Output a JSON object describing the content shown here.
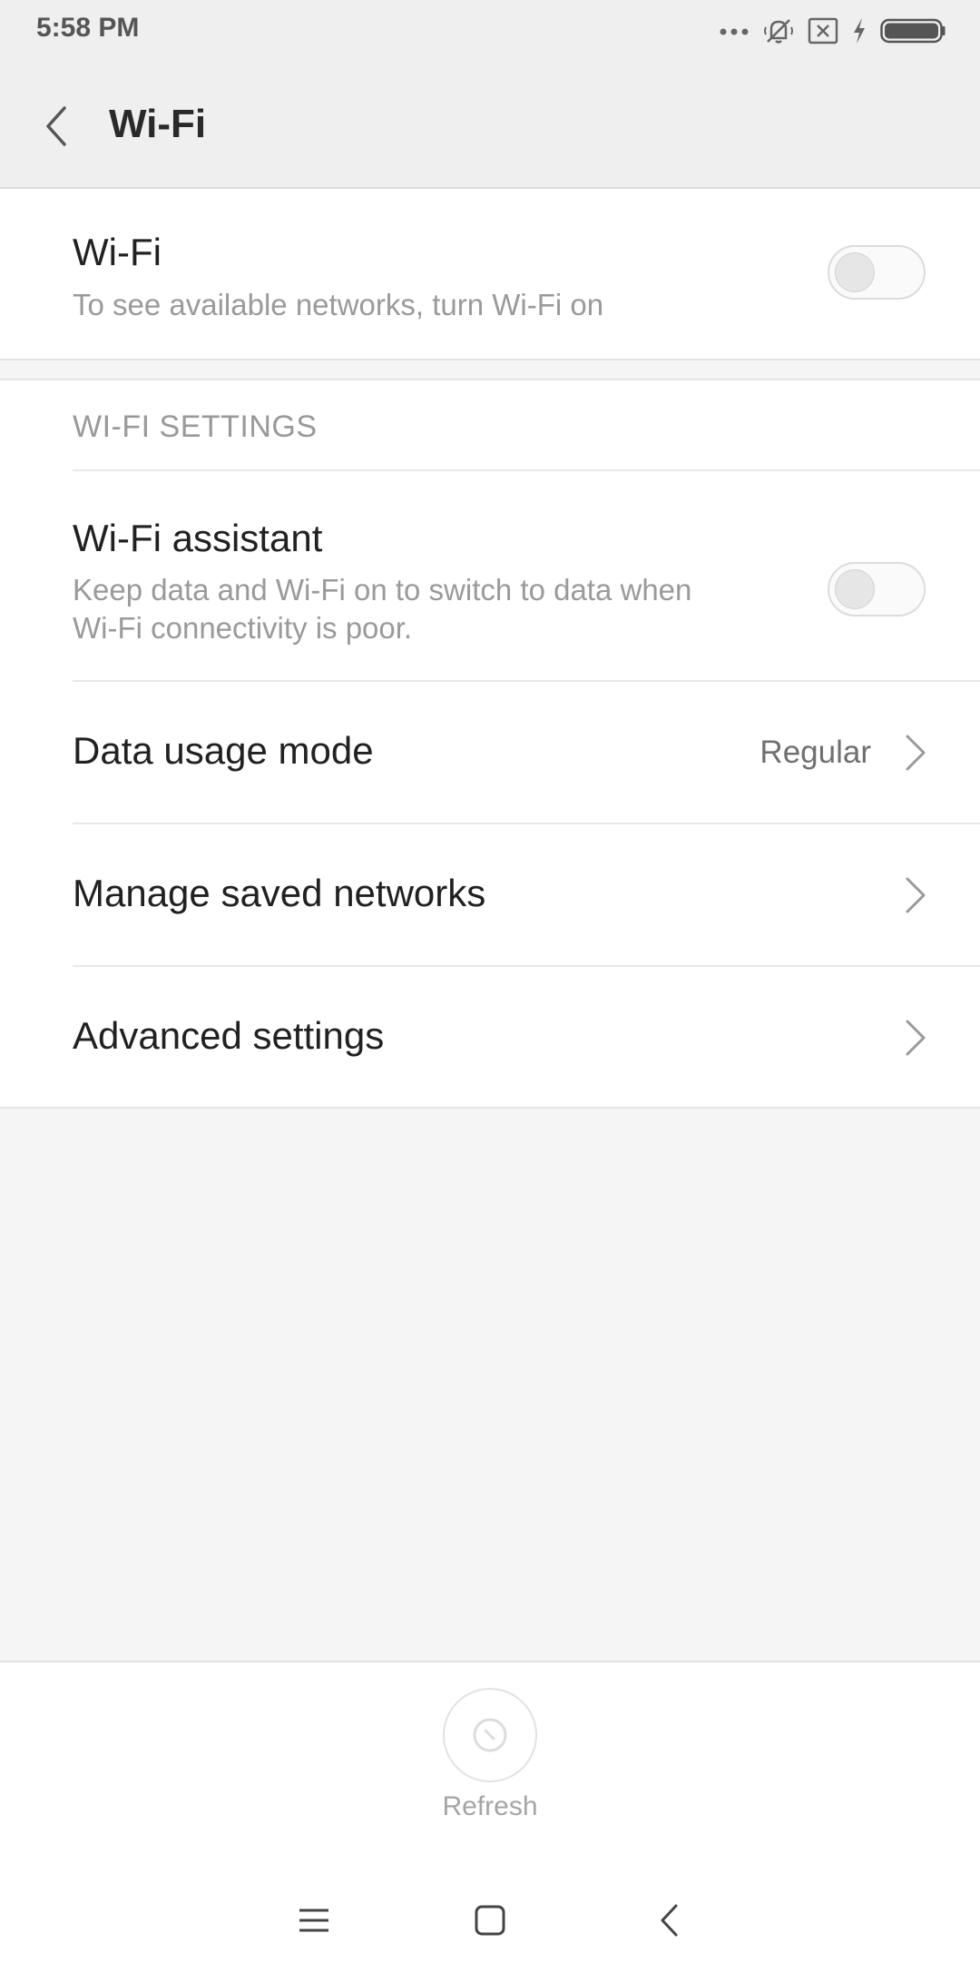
{
  "status_bar": {
    "time": "5:58 PM",
    "icons": [
      "more-dots-icon",
      "silent-bell-icon",
      "no-sim-icon",
      "charging-bolt-icon",
      "battery-icon"
    ]
  },
  "action_bar": {
    "title": "Wi-Fi",
    "back_icon": "back-arrow-icon"
  },
  "wifi_toggle": {
    "title": "Wi-Fi",
    "subtitle": "To see available networks, turn Wi-Fi on",
    "enabled": false
  },
  "settings": {
    "section_header": "WI-FI SETTINGS",
    "assistant": {
      "title": "Wi-Fi assistant",
      "subtitle_line1": "Keep data and Wi-Fi on to switch to data when",
      "subtitle_line2": "Wi-Fi connectivity is poor.",
      "enabled": false
    },
    "data_usage": {
      "title": "Data usage mode",
      "value": "Regular"
    },
    "saved_networks": {
      "title": "Manage saved networks"
    },
    "advanced": {
      "title": "Advanced settings"
    }
  },
  "bottom": {
    "refresh_label": "Refresh"
  },
  "nav_bar": {
    "buttons": [
      "menu-icon",
      "home-icon",
      "back-icon"
    ]
  },
  "colors": {
    "header_bg": "#efefef",
    "page_bg": "#f5f5f5",
    "card_bg": "#ffffff",
    "secondary_text": "#9a9a9a"
  }
}
